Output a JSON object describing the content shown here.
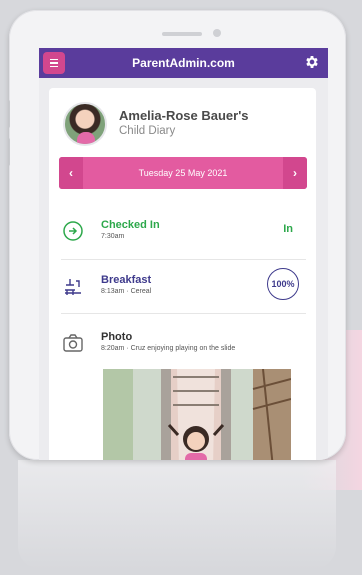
{
  "app": {
    "title": "ParentAdmin.com"
  },
  "profile": {
    "name": "Amelia-Rose Bauer's",
    "subtitle": "Child Diary"
  },
  "date_nav": {
    "prev": "‹",
    "date": "Tuesday 25 May 2021",
    "next": "›"
  },
  "entries": [
    {
      "title": "Checked In",
      "subtitle": "7:30am",
      "status": "In",
      "color": "#2da84b",
      "icon": "check-in-icon"
    },
    {
      "title": "Breakfast",
      "subtitle": "8:13am · Cereal",
      "badge": "100%",
      "color": "#3e3a8c",
      "icon": "high-chair-icon"
    },
    {
      "title": "Photo",
      "subtitle": "8:20am · Cruz enjoying playing on the slide",
      "color": "#333333",
      "icon": "camera-icon"
    }
  ],
  "colors": {
    "header": "#5a3c9c",
    "accent": "#e35ba0",
    "accent_dark": "#d2478e"
  }
}
